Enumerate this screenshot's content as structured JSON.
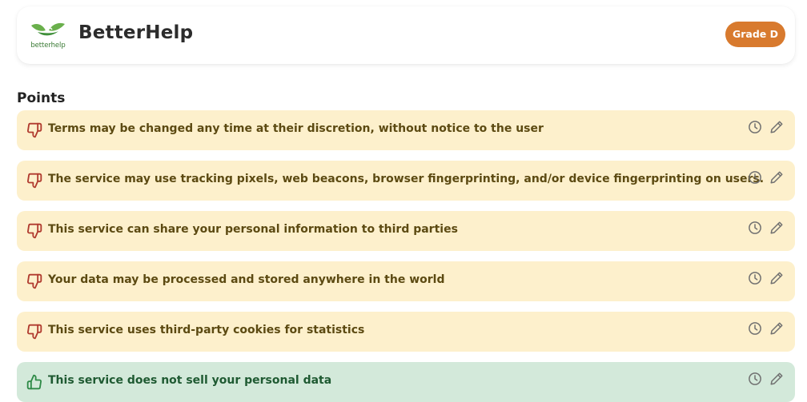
{
  "header": {
    "logo_text": "betterhelp",
    "title": "BetterHelp",
    "grade_label": "Grade D",
    "grade_color": "#d87a2e"
  },
  "section": {
    "title": "Points"
  },
  "colors": {
    "bad_bg": "#fdf0cc",
    "bad_text": "#5c4a12",
    "bad_icon": "#b03a2e",
    "good_bg": "#d3e9da",
    "good_text": "#1f5a32",
    "good_icon": "#2e8a47",
    "action_icon": "#707070"
  },
  "points": [
    {
      "text": "Terms may be changed any time at their discretion, without notice to the user",
      "kind": "bad",
      "icon": "thumbs-down-icon"
    },
    {
      "text": "The service may use tracking pixels, web beacons, browser fingerprinting, and/or device fingerprinting on users.",
      "kind": "bad",
      "icon": "thumbs-down-icon"
    },
    {
      "text": "This service can share your personal information to third parties",
      "kind": "bad",
      "icon": "thumbs-down-icon"
    },
    {
      "text": "Your data may be processed and stored anywhere in the world",
      "kind": "bad",
      "icon": "thumbs-down-icon"
    },
    {
      "text": "This service uses third-party cookies for statistics",
      "kind": "bad",
      "icon": "thumbs-down-icon"
    },
    {
      "text": "This service does not sell your personal data",
      "kind": "good",
      "icon": "thumbs-up-icon"
    }
  ]
}
